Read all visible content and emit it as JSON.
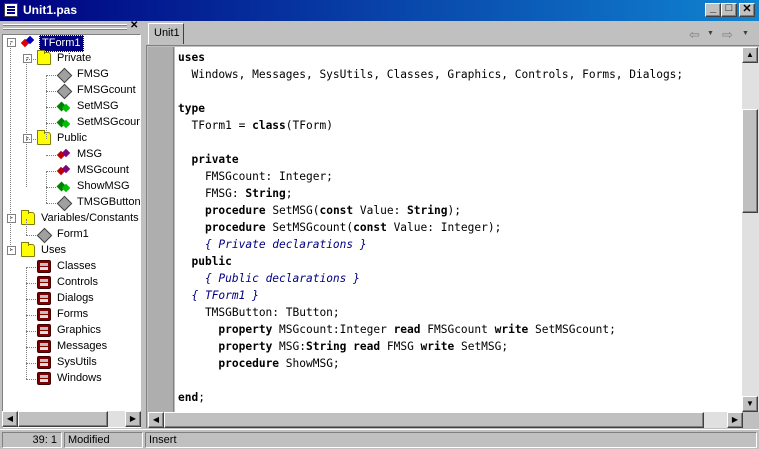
{
  "window": {
    "title": "Unit1.pas",
    "minimize_glyph": "_",
    "maximize_glyph": "□",
    "close_glyph": "✕"
  },
  "explorer": {
    "close_glyph": "✕",
    "nodes": [
      {
        "label": "TForm1",
        "icon": "class-icon",
        "level": 0,
        "expander": "-",
        "selected": true
      },
      {
        "label": "Private",
        "icon": "folder-icon",
        "level": 1,
        "expander": "-"
      },
      {
        "label": "FMSG",
        "icon": "field-icon",
        "level": 2
      },
      {
        "label": "FMSGcount",
        "icon": "field-icon",
        "level": 2
      },
      {
        "label": "SetMSG",
        "icon": "method-icon",
        "level": 2
      },
      {
        "label": "SetMSGcount",
        "icon": "method-icon",
        "level": 2
      },
      {
        "label": "Public",
        "icon": "folder-icon",
        "level": 1,
        "expander": "-"
      },
      {
        "label": "MSG",
        "icon": "prop-icon",
        "level": 2
      },
      {
        "label": "MSGcount",
        "icon": "prop-icon",
        "level": 2
      },
      {
        "label": "ShowMSG",
        "icon": "method-icon",
        "level": 2
      },
      {
        "label": "TMSGButton",
        "icon": "field-icon",
        "level": 2
      },
      {
        "label": "Variables/Constants",
        "icon": "folder-icon",
        "level": 0,
        "expander": "-"
      },
      {
        "label": "Form1",
        "icon": "field-icon",
        "level": 1
      },
      {
        "label": "Uses",
        "icon": "folder-icon",
        "level": 0,
        "expander": "-"
      },
      {
        "label": "Classes",
        "icon": "unit-icon",
        "level": 1
      },
      {
        "label": "Controls",
        "icon": "unit-icon",
        "level": 1
      },
      {
        "label": "Dialogs",
        "icon": "unit-icon",
        "level": 1
      },
      {
        "label": "Forms",
        "icon": "unit-icon",
        "level": 1
      },
      {
        "label": "Graphics",
        "icon": "unit-icon",
        "level": 1
      },
      {
        "label": "Messages",
        "icon": "unit-icon",
        "level": 1
      },
      {
        "label": "SysUtils",
        "icon": "unit-icon",
        "level": 1
      },
      {
        "label": "Windows",
        "icon": "unit-icon",
        "level": 1
      }
    ]
  },
  "editor": {
    "tab_label": "Unit1",
    "back_glyph": "⇦",
    "forward_glyph": "⇨",
    "dropdown_glyph": "▼",
    "lines": [
      [
        {
          "t": "uses",
          "s": "kw"
        }
      ],
      [
        {
          "t": "  Windows, Messages, SysUtils, Classes, Graphics, Controls, Forms, Dialogs;"
        }
      ],
      [
        {
          "t": ""
        }
      ],
      [
        {
          "t": "type",
          "s": "kw"
        }
      ],
      [
        {
          "t": "  TForm1 = "
        },
        {
          "t": "class",
          "s": "kw"
        },
        {
          "t": "(TForm)"
        }
      ],
      [
        {
          "t": ""
        }
      ],
      [
        {
          "t": "  "
        },
        {
          "t": "private",
          "s": "kw"
        }
      ],
      [
        {
          "t": "    FMSGcount: Integer;"
        }
      ],
      [
        {
          "t": "    FMSG: "
        },
        {
          "t": "String",
          "s": "kw"
        },
        {
          "t": ";"
        }
      ],
      [
        {
          "t": "    "
        },
        {
          "t": "procedure",
          "s": "kw"
        },
        {
          "t": " SetMSG("
        },
        {
          "t": "const",
          "s": "kw"
        },
        {
          "t": " Value: "
        },
        {
          "t": "String",
          "s": "kw"
        },
        {
          "t": ");"
        }
      ],
      [
        {
          "t": "    "
        },
        {
          "t": "procedure",
          "s": "kw"
        },
        {
          "t": " SetMSGcount("
        },
        {
          "t": "const",
          "s": "kw"
        },
        {
          "t": " Value: Integer);"
        }
      ],
      [
        {
          "t": "    "
        },
        {
          "t": "{ Private declarations }",
          "s": "cm"
        }
      ],
      [
        {
          "t": "  "
        },
        {
          "t": "public",
          "s": "kw"
        }
      ],
      [
        {
          "t": "    "
        },
        {
          "t": "{ Public declarations }",
          "s": "cm"
        }
      ],
      [
        {
          "t": "  "
        },
        {
          "t": "{ TForm1 }",
          "s": "cm"
        }
      ],
      [
        {
          "t": "    TMSGButton: TButton;"
        }
      ],
      [
        {
          "t": "      "
        },
        {
          "t": "property",
          "s": "kw"
        },
        {
          "t": " MSGcount:Integer "
        },
        {
          "t": "read",
          "s": "kw"
        },
        {
          "t": " FMSGcount "
        },
        {
          "t": "write",
          "s": "kw"
        },
        {
          "t": " SetMSGcount;"
        }
      ],
      [
        {
          "t": "      "
        },
        {
          "t": "property",
          "s": "kw"
        },
        {
          "t": " MSG:"
        },
        {
          "t": "String",
          "s": "kw"
        },
        {
          "t": " "
        },
        {
          "t": "read",
          "s": "kw"
        },
        {
          "t": " FMSG "
        },
        {
          "t": "write",
          "s": "kw"
        },
        {
          "t": " SetMSG;"
        }
      ],
      [
        {
          "t": "      "
        },
        {
          "t": "procedure",
          "s": "kw"
        },
        {
          "t": " ShowMSG;"
        }
      ],
      [
        {
          "t": ""
        }
      ],
      [
        {
          "t": "end",
          "s": "kw"
        },
        {
          "t": ";"
        }
      ]
    ]
  },
  "scroll": {
    "up": "▲",
    "down": "▼",
    "left": "◀",
    "right": "▶"
  },
  "status": {
    "position": "39:  1",
    "modified": "Modified",
    "mode": "Insert"
  },
  "colors": {
    "title_start": "#000080",
    "title_end": "#1084d0",
    "selection": "#000080",
    "comment": "#000080"
  }
}
